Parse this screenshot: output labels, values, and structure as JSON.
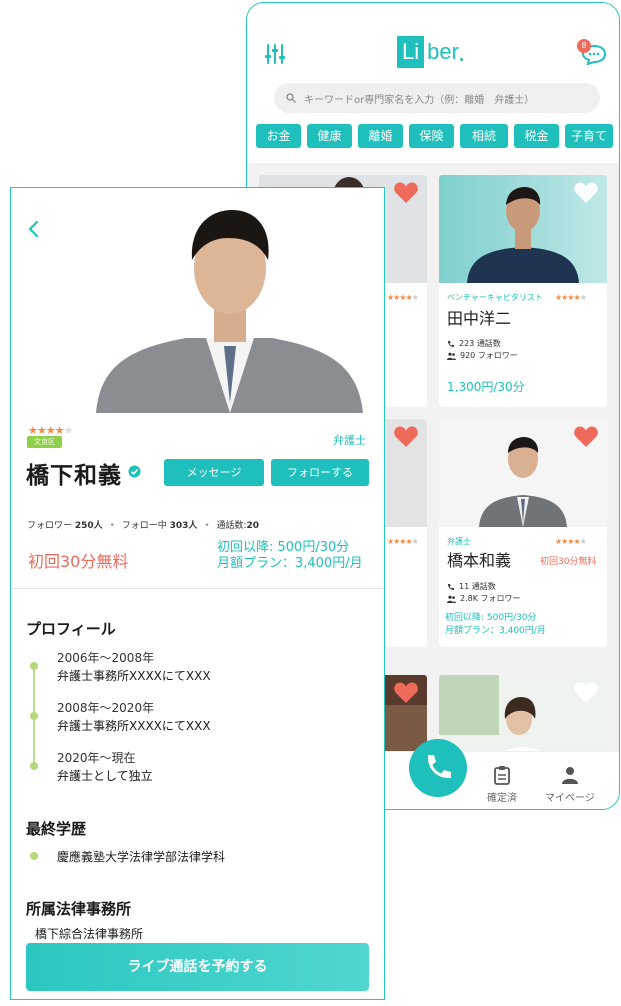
{
  "list_screen": {
    "logo": {
      "box": "Li",
      "rest": "ber"
    },
    "chat_badge": "8",
    "search_placeholder": "キーワードor専門家名を入力（例：離婚　弁護士）",
    "categories": [
      "お金",
      "健康",
      "離婚",
      "保険",
      "相続",
      "税金",
      "子育て"
    ],
    "cards": [
      {
        "role": "ベンチャーキャピタリスト",
        "name": "田中洋二",
        "calls": "223 通話数",
        "followers": "920 フォロワー",
        "price": "1,300円/30分",
        "rating": 4
      },
      {
        "role": "弁護士",
        "name": "橋本和義",
        "free": "初回30分無料",
        "calls": "11 通話数",
        "followers": "2.8K フォロワー",
        "price_line1": "初回以降: 500円/30分",
        "price_line2": "月額プラン：3,400円/月",
        "rating": 4
      }
    ],
    "tabs": [
      {
        "label": "確定済",
        "icon": "clipboard-icon"
      },
      {
        "label": "マイページ",
        "icon": "person-icon"
      }
    ]
  },
  "profile_screen": {
    "rating": 4,
    "location_badge": "文京区",
    "role": "弁護士",
    "name": "橋下和義",
    "message_button": "メッセージ",
    "follow_button": "フォローする",
    "stats": {
      "followers_label": "フォロワー",
      "followers_value": "250人",
      "following_label": "フォロー中",
      "following_value": "303人",
      "calls_label": "通話数:",
      "calls_value": "20"
    },
    "free_offer": "初回30分無料",
    "price_line1": "初回以降: 500円/30分",
    "price_line2": "月額プラン：3,400円/月",
    "profile_title": "プロフィール",
    "timeline": [
      {
        "year": "2006年〜2008年",
        "text": "弁護士事務所XXXXにてXXX"
      },
      {
        "year": "2008年〜2020年",
        "text": "弁護士事務所XXXXにてXXX"
      },
      {
        "year": "2020年〜現在",
        "text": "弁護士として独立"
      }
    ],
    "education_title": "最終学歴",
    "education": "慶應義塾大学法律学部法律学科",
    "firm_title": "所属法律事務所",
    "firm": "橋下綜合法律事務所",
    "reserve_button": "ライブ通話を予約する"
  },
  "colors": {
    "accent": "#1fc0bb",
    "red": "#ef6a5a",
    "star": "#f08c45",
    "green": "#8fcf4a"
  }
}
